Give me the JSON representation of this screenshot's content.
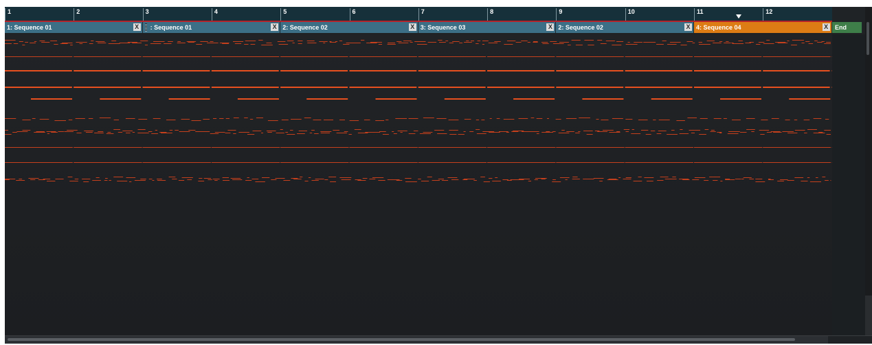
{
  "ruler": {
    "bars": [
      "1",
      "2",
      "3",
      "4",
      "5",
      "6",
      "7",
      "8",
      "9",
      "10",
      "11",
      "12"
    ]
  },
  "sequences": [
    {
      "label": "1: Sequence 01",
      "has_close": false,
      "active": false
    },
    {
      "label": ": Sequence 01",
      "has_close": true,
      "active": false
    },
    {
      "label": "2: Sequence 02",
      "has_close": true,
      "active": false
    },
    {
      "label": "3: Sequence 03",
      "has_close": true,
      "active": false
    },
    {
      "label": "2: Sequence 02",
      "has_close": true,
      "active": false
    },
    {
      "label": "4: Sequence 04",
      "has_close": true,
      "active": true
    }
  ],
  "end_label": "End",
  "close_glyph": "X",
  "colors": {
    "note": "#e8501f",
    "note_thin": "#c6401c",
    "sequence_block": "#3c6f86",
    "active_sequence": "#dd7c14",
    "end_block": "#3e7e49",
    "ruler_line": "#b4232a"
  }
}
